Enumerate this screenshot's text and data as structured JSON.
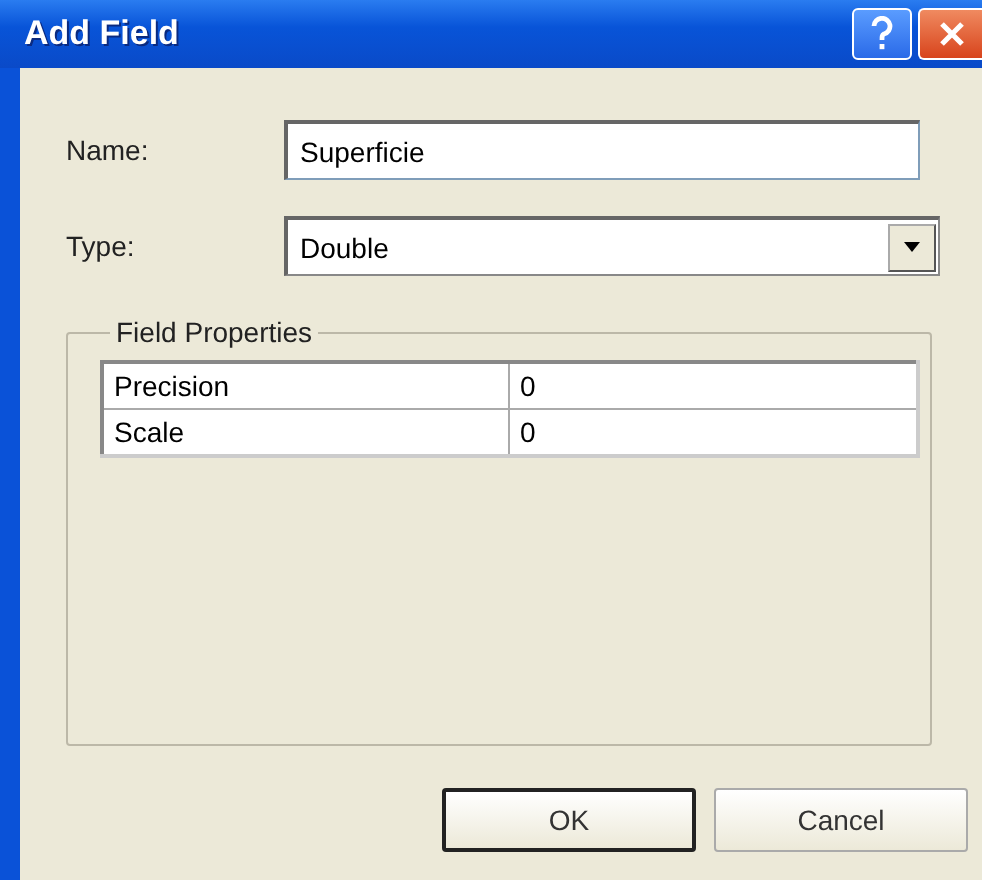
{
  "window": {
    "title": "Add Field"
  },
  "name_field": {
    "label": "Name:",
    "value": "Superficie"
  },
  "type_field": {
    "label": "Type:",
    "value": "Double"
  },
  "field_properties": {
    "title": "Field Properties",
    "rows": [
      {
        "property": "Precision",
        "value": "0"
      },
      {
        "property": "Scale",
        "value": "0"
      }
    ]
  },
  "buttons": [
    {
      "label": "OK",
      "default": true
    },
    {
      "label": "Cancel",
      "default": false
    }
  ]
}
